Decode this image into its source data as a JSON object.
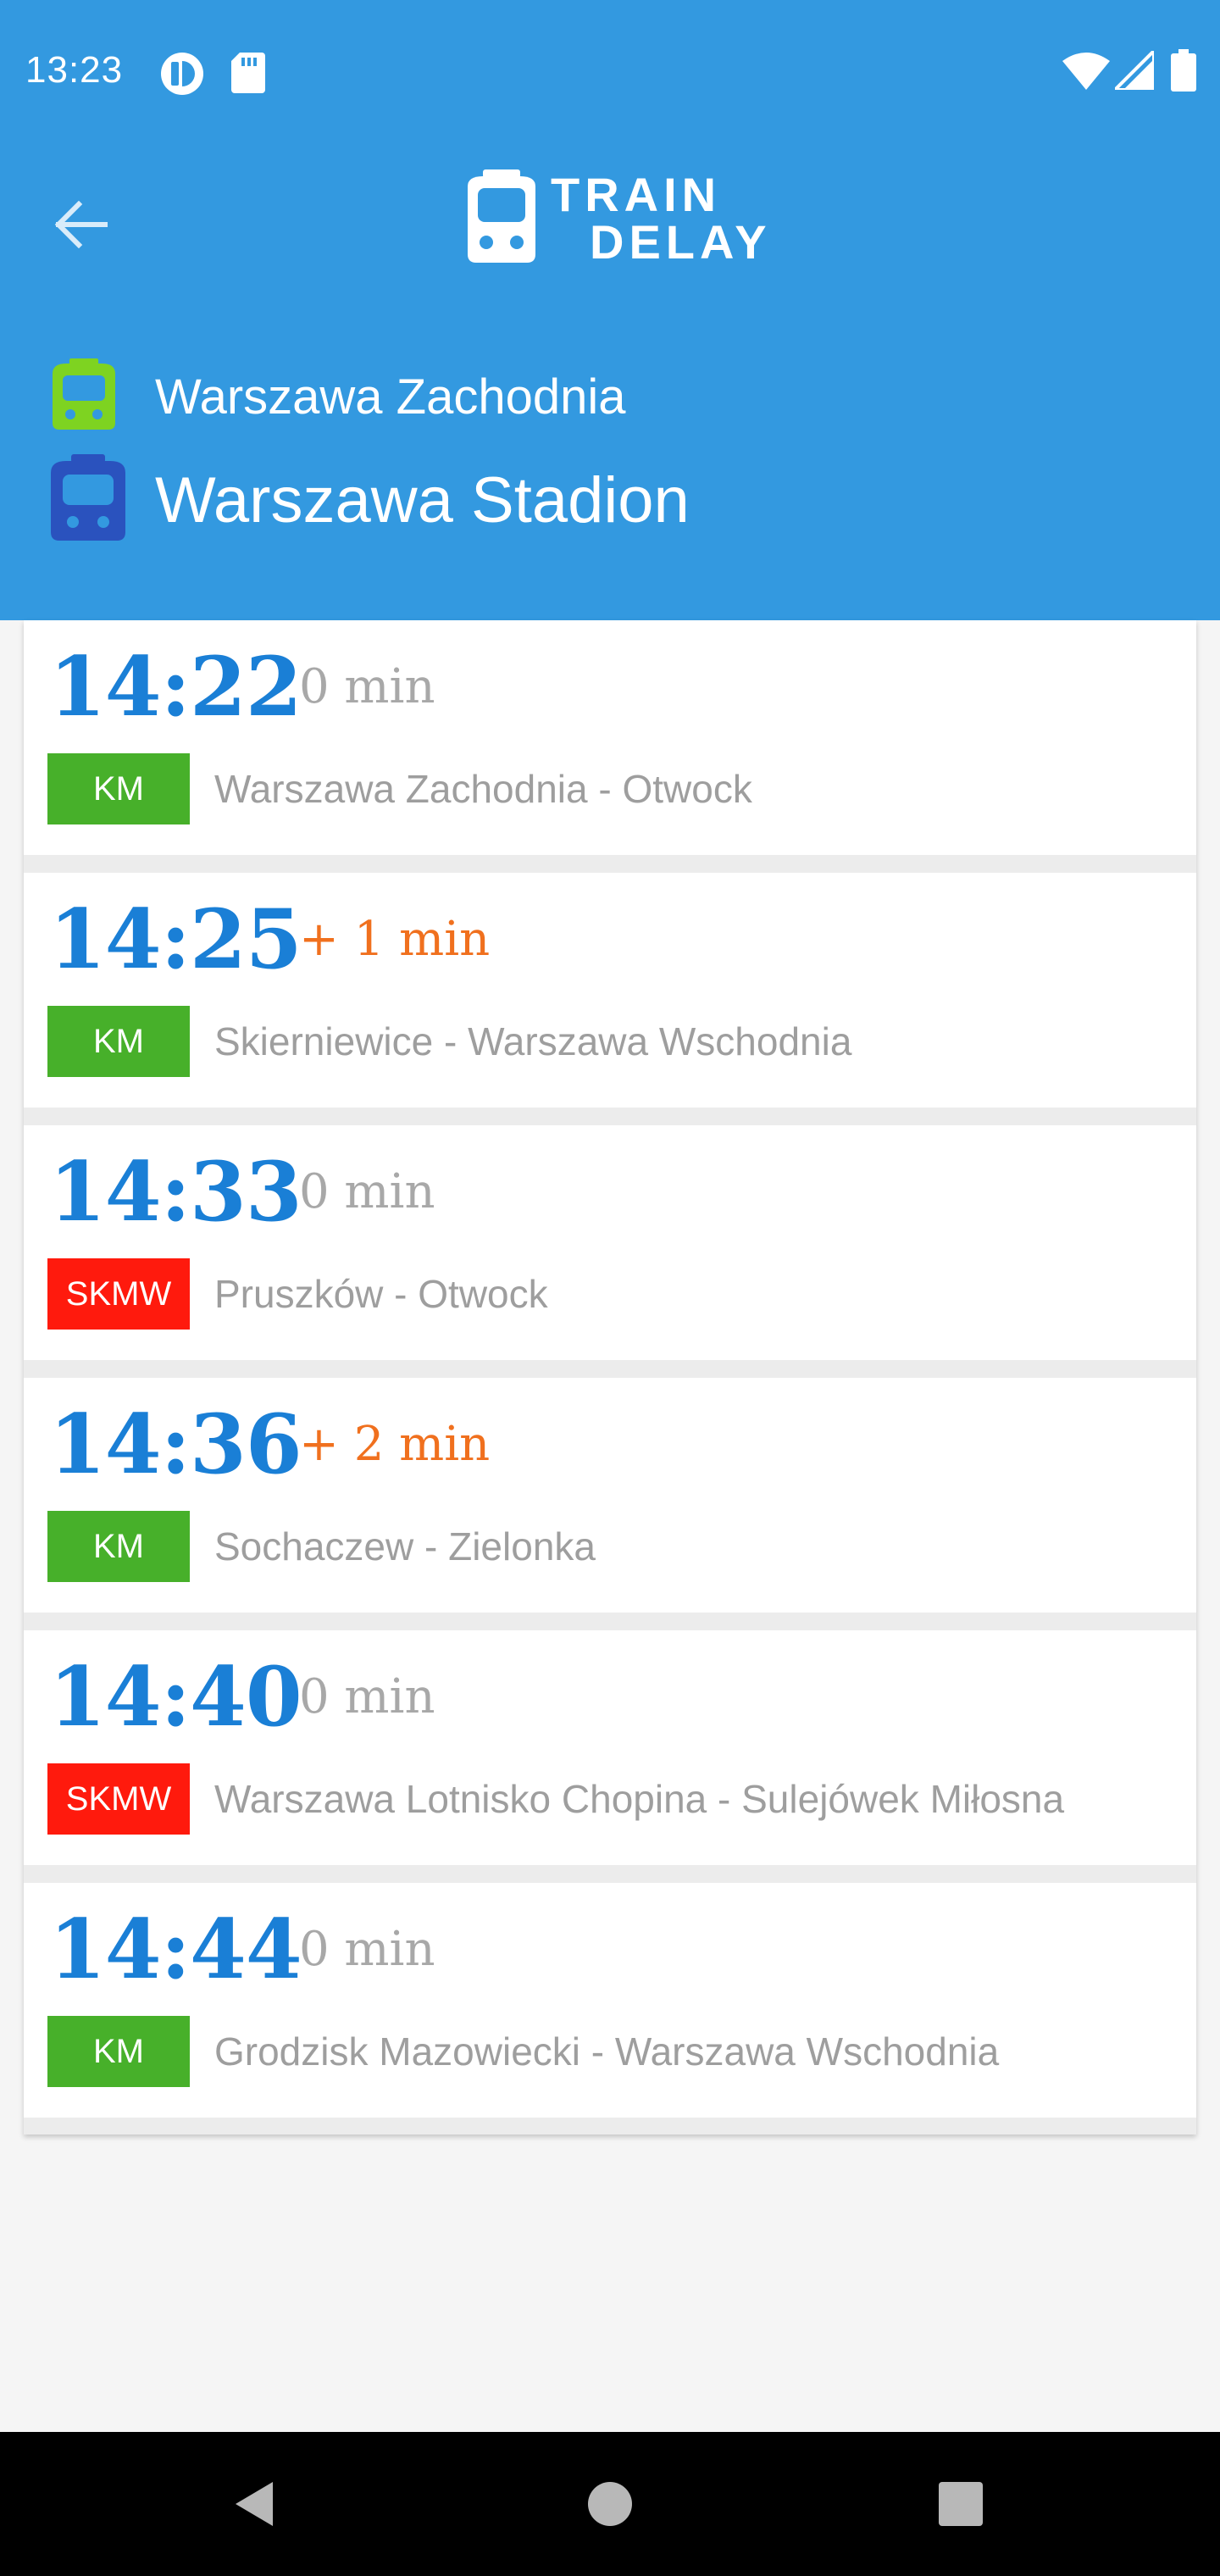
{
  "status_bar": {
    "time": "13:23",
    "icons_left": [
      "app-notification-icon",
      "sd-card-icon"
    ],
    "icons_right": [
      "wifi-icon",
      "signal-icon",
      "battery-icon"
    ]
  },
  "app_bar": {
    "back_icon": "arrow-left-icon",
    "logo_line1": "TRAIN",
    "logo_line2": "DELAY"
  },
  "stations": {
    "from": "Warszawa Zachodnia",
    "to": "Warszawa Stadion",
    "from_icon_color": "#7ed321",
    "to_icon_color": "#2a52be"
  },
  "colors": {
    "header": "#3399e0",
    "time": "#1a7fd6",
    "late": "#f0701e",
    "ontime": "#a8a8a8",
    "km": "#47b02a",
    "skmw": "#ff1a0d"
  },
  "trains": [
    {
      "time": "14:22",
      "delay": "0 min",
      "late": false,
      "carrier": "KM",
      "route": "Warszawa Zachodnia - Otwock"
    },
    {
      "time": "14:25",
      "delay": "+ 1 min",
      "late": true,
      "carrier": "KM",
      "route": "Skierniewice - Warszawa Wschodnia"
    },
    {
      "time": "14:33",
      "delay": "0 min",
      "late": false,
      "carrier": "SKMW",
      "route": "Pruszków - Otwock"
    },
    {
      "time": "14:36",
      "delay": "+ 2 min",
      "late": true,
      "carrier": "KM",
      "route": "Sochaczew - Zielonka"
    },
    {
      "time": "14:40",
      "delay": "0 min",
      "late": false,
      "carrier": "SKMW",
      "route": "Warszawa Lotnisko Chopina - Sulejówek Miłosna"
    },
    {
      "time": "14:44",
      "delay": "0 min",
      "late": false,
      "carrier": "KM",
      "route": "Grodzisk Mazowiecki - Warszawa Wschodnia"
    }
  ],
  "nav_bar": [
    "back-triangle-icon",
    "home-circle-icon",
    "recents-square-icon"
  ]
}
